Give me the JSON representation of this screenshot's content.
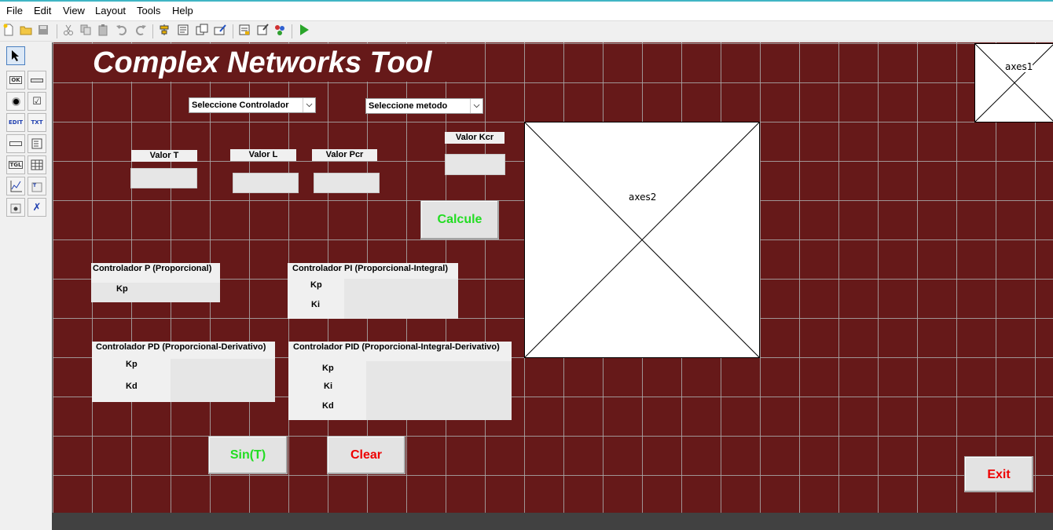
{
  "menu": [
    "File",
    "Edit",
    "View",
    "Layout",
    "Tools",
    "Help"
  ],
  "toolbar_icons": [
    "new-file-icon",
    "open-folder-icon",
    "save-icon",
    "cut-icon",
    "copy-icon",
    "paste-icon",
    "undo-icon",
    "redo-icon",
    "align-icon",
    "menu-editor-icon",
    "tab-order-icon",
    "toolbar-editor-icon",
    "editor-icon",
    "property-inspector-icon",
    "object-browser-icon",
    "run-icon"
  ],
  "palette": {
    "items": [
      "select",
      "push-button",
      "slider",
      "radio-button",
      "checkbox",
      "edit-text",
      "static-text",
      "popup-menu",
      "listbox",
      "toggle-button",
      "table",
      "axes",
      "panel",
      "button-group",
      "activex"
    ],
    "labels": {
      "push": "OK",
      "slider": "",
      "edit": "EDIT",
      "text": "TXT",
      "toggle": "TGL"
    }
  },
  "gui": {
    "title": "Complex Networks Tool",
    "controller_select": "Seleccione Controlador",
    "method_select": "Seleccione metodo",
    "valor_t": "Valor T",
    "valor_l": "Valor  L",
    "valor_pcr": "Valor Pcr",
    "valor_kcr": "Valor Kcr",
    "calcule": "Calcule",
    "sin_t": "Sin(T)",
    "clear": "Clear",
    "exit": "Exit",
    "panel_p": {
      "title": "Controlador P (Proporcional)",
      "kp": "Kp"
    },
    "panel_pi": {
      "title": "Controlador PI (Proporcional-Integral)",
      "kp": "Kp",
      "ki": "Ki"
    },
    "panel_pd": {
      "title": "Controlador PD (Proporcional-Derivativo)",
      "kp": "Kp",
      "kd": "Kd"
    },
    "panel_pid": {
      "title": "Controlador PID (Proporcional-Integral-Derivativo)",
      "kp": "Kp",
      "ki": "Ki",
      "kd": "Kd"
    },
    "axes1": "axes1",
    "axes2": "axes2"
  },
  "colors": {
    "canvas": "#661919",
    "green_text": "#22dd22",
    "red_text": "#ee0000"
  }
}
